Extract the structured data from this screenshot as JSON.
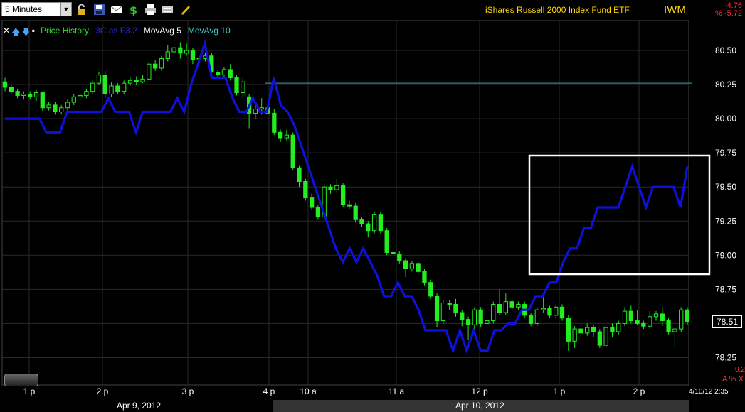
{
  "toolbar": {
    "timeframe": "5 Minutes",
    "icons": [
      "lock-icon",
      "save-icon",
      "mail-icon",
      "dollar-icon",
      "print-icon",
      "screen-icon",
      "pencil-icon"
    ]
  },
  "header": {
    "title": "iShares Russell 2000 Index Fund ETF",
    "symbol": "IWM",
    "change": "-4.76",
    "change_pct": "% -5.72"
  },
  "legend": {
    "price_history": "Price History",
    "indicator": "3C as F3.2",
    "ma5": "MovAvg 5",
    "ma10": "MovAvg 10"
  },
  "last_price": "78.51",
  "right_small": "0.25",
  "alx_label": "A % X",
  "timestamp": "4/10/12 2:35",
  "colors": {
    "background": "#000000",
    "candle": "#22ee22",
    "indicator": "#1010dd",
    "ma_line": "#2a8a8a",
    "grid": "#2a2a2a",
    "title": "#ffd800",
    "negative": "#ff3030"
  },
  "chart_data": {
    "type": "candlestick",
    "yaxis": {
      "ticks": [
        "80.50",
        "80.25",
        "80.00",
        "79.75",
        "79.50",
        "79.25",
        "79.00",
        "78.75",
        "78.50",
        "78.25"
      ],
      "ylim": [
        78.125,
        80.625
      ]
    },
    "xaxis": {
      "time_labels": [
        "1 p",
        "2 p",
        "3 p",
        "4 p",
        "10 a",
        "11 a",
        "12 p",
        "1 p",
        "2 p"
      ],
      "date_labels": [
        "Apr 9, 2012",
        "Apr 10, 2012"
      ]
    },
    "ma_level": 80.26,
    "candles": [
      [
        80.27,
        80.23,
        80.3,
        80.2
      ],
      [
        80.23,
        80.2,
        80.25,
        80.18
      ],
      [
        80.2,
        80.17,
        80.22,
        80.15
      ],
      [
        80.17,
        80.18,
        80.2,
        80.14
      ],
      [
        80.18,
        80.16,
        80.2,
        80.14
      ],
      [
        80.16,
        80.19,
        80.21,
        80.13
      ],
      [
        80.19,
        80.08,
        80.2,
        80.06
      ],
      [
        80.08,
        80.1,
        80.12,
        80.06
      ],
      [
        80.1,
        80.05,
        80.12,
        80.03
      ],
      [
        80.05,
        80.08,
        80.1,
        80.03
      ],
      [
        80.08,
        80.12,
        80.14,
        80.06
      ],
      [
        80.12,
        80.16,
        80.18,
        80.1
      ],
      [
        80.16,
        80.17,
        80.19,
        80.13
      ],
      [
        80.17,
        80.2,
        80.22,
        80.15
      ],
      [
        80.2,
        80.26,
        80.28,
        80.18
      ],
      [
        80.26,
        80.32,
        80.34,
        80.25
      ],
      [
        80.32,
        80.18,
        80.35,
        80.15
      ],
      [
        80.18,
        80.24,
        80.27,
        80.16
      ],
      [
        80.24,
        80.2,
        80.26,
        80.18
      ],
      [
        80.2,
        80.26,
        80.28,
        80.18
      ],
      [
        80.26,
        80.28,
        80.3,
        80.24
      ],
      [
        80.28,
        80.27,
        80.31,
        80.25
      ],
      [
        80.27,
        80.29,
        80.32,
        80.26
      ],
      [
        80.29,
        80.4,
        80.42,
        80.28
      ],
      [
        80.4,
        80.37,
        80.43,
        80.35
      ],
      [
        80.37,
        80.44,
        80.46,
        80.35
      ],
      [
        80.44,
        80.49,
        80.54,
        80.42
      ],
      [
        80.49,
        80.52,
        80.58,
        80.47
      ],
      [
        80.52,
        80.48,
        80.56,
        80.44
      ],
      [
        80.48,
        80.5,
        80.55,
        80.46
      ],
      [
        80.5,
        80.43,
        80.52,
        80.4
      ],
      [
        80.43,
        80.44,
        80.46,
        80.41
      ],
      [
        80.44,
        80.46,
        80.48,
        80.42
      ],
      [
        80.46,
        80.34,
        80.48,
        80.32
      ],
      [
        80.34,
        80.32,
        80.36,
        80.3
      ],
      [
        80.32,
        80.36,
        80.38,
        80.3
      ],
      [
        80.36,
        80.3,
        80.4,
        80.28
      ],
      [
        80.3,
        80.19,
        80.32,
        80.17
      ],
      [
        80.19,
        80.27,
        80.3,
        80.15
      ],
      [
        80.16,
        80.04,
        80.18,
        79.93
      ],
      [
        80.04,
        80.07,
        80.12,
        80.0
      ],
      [
        80.07,
        80.08,
        80.15,
        80.03
      ],
      [
        80.08,
        80.04,
        80.12,
        80.0
      ],
      [
        80.04,
        79.9,
        80.07,
        79.88
      ],
      [
        79.9,
        79.86,
        79.92,
        79.83
      ],
      [
        79.86,
        79.88,
        79.92,
        79.84
      ],
      [
        79.88,
        79.64,
        79.9,
        79.62
      ],
      [
        79.64,
        79.54,
        79.66,
        79.5
      ],
      [
        79.54,
        79.42,
        79.56,
        79.4
      ],
      [
        79.42,
        79.35,
        79.45,
        79.33
      ],
      [
        79.35,
        79.28,
        79.37,
        79.26
      ],
      [
        79.28,
        79.5,
        79.52,
        79.26
      ],
      [
        79.5,
        79.48,
        79.52,
        79.45
      ],
      [
        79.48,
        79.51,
        79.56,
        79.46
      ],
      [
        79.51,
        79.37,
        79.53,
        79.35
      ],
      [
        79.37,
        79.36,
        79.4,
        79.34
      ],
      [
        79.36,
        79.26,
        79.38,
        79.24
      ],
      [
        79.26,
        79.23,
        79.28,
        79.21
      ],
      [
        79.23,
        79.18,
        79.25,
        79.13
      ],
      [
        79.18,
        79.3,
        79.32,
        79.16
      ],
      [
        79.3,
        79.18,
        79.32,
        79.16
      ],
      [
        79.18,
        79.02,
        79.2,
        79.0
      ],
      [
        79.02,
        79.01,
        79.05,
        78.99
      ],
      [
        79.01,
        78.96,
        79.03,
        78.94
      ],
      [
        78.96,
        78.9,
        78.98,
        78.84
      ],
      [
        78.9,
        78.94,
        78.96,
        78.88
      ],
      [
        78.94,
        78.88,
        78.96,
        78.86
      ],
      [
        78.88,
        78.8,
        78.9,
        78.78
      ],
      [
        78.8,
        78.7,
        78.82,
        78.68
      ],
      [
        78.7,
        78.52,
        78.72,
        78.47
      ],
      [
        78.52,
        78.65,
        78.67,
        78.5
      ],
      [
        78.65,
        78.64,
        78.67,
        78.6
      ],
      [
        78.64,
        78.58,
        78.68,
        78.55
      ],
      [
        78.58,
        78.53,
        78.6,
        78.48
      ],
      [
        78.53,
        78.49,
        78.55,
        78.38
      ],
      [
        78.49,
        78.6,
        78.62,
        78.42
      ],
      [
        78.6,
        78.5,
        78.62,
        78.47
      ],
      [
        78.5,
        78.52,
        78.55,
        78.46
      ],
      [
        78.52,
        78.64,
        78.66,
        78.5
      ],
      [
        78.64,
        78.58,
        78.75,
        78.56
      ],
      [
        78.58,
        78.66,
        78.72,
        78.56
      ],
      [
        78.66,
        78.62,
        78.68,
        78.6
      ],
      [
        78.62,
        78.64,
        78.66,
        78.6
      ],
      [
        78.64,
        78.56,
        78.66,
        78.54
      ],
      [
        78.56,
        78.5,
        78.58,
        78.48
      ],
      [
        78.5,
        78.6,
        78.62,
        78.48
      ],
      [
        78.6,
        78.61,
        78.7,
        78.58
      ],
      [
        78.61,
        78.56,
        78.63,
        78.54
      ],
      [
        78.56,
        78.62,
        78.64,
        78.54
      ],
      [
        78.62,
        78.54,
        78.64,
        78.52
      ],
      [
        78.54,
        78.37,
        78.56,
        78.3
      ],
      [
        78.37,
        78.46,
        78.48,
        78.32
      ],
      [
        78.46,
        78.43,
        78.48,
        78.38
      ],
      [
        78.43,
        78.47,
        78.5,
        78.41
      ],
      [
        78.47,
        78.44,
        78.49,
        78.4
      ],
      [
        78.44,
        78.34,
        78.46,
        78.32
      ],
      [
        78.34,
        78.47,
        78.49,
        78.32
      ],
      [
        78.47,
        78.44,
        78.5,
        78.4
      ],
      [
        78.44,
        78.5,
        78.52,
        78.42
      ],
      [
        78.5,
        78.59,
        78.62,
        78.48
      ],
      [
        78.59,
        78.52,
        78.63,
        78.5
      ],
      [
        78.52,
        78.5,
        78.6,
        78.49
      ],
      [
        78.5,
        78.48,
        78.52,
        78.46
      ],
      [
        78.48,
        78.55,
        78.59,
        78.46
      ],
      [
        78.55,
        78.57,
        78.59,
        78.52
      ],
      [
        78.57,
        78.52,
        78.62,
        78.48
      ],
      [
        78.52,
        78.44,
        78.54,
        78.42
      ],
      [
        78.44,
        78.46,
        78.48,
        78.33
      ],
      [
        78.46,
        78.6,
        78.62,
        78.44
      ],
      [
        78.6,
        78.51,
        78.62,
        78.49
      ]
    ],
    "indicator": [
      80.0,
      80.0,
      80.0,
      80.0,
      80.0,
      80.0,
      79.9,
      79.9,
      79.9,
      80.05,
      80.05,
      80.05,
      80.05,
      80.05,
      80.05,
      80.15,
      80.05,
      80.05,
      80.05,
      79.9,
      80.05,
      80.05,
      80.05,
      80.05,
      80.05,
      80.15,
      80.05,
      80.25,
      80.4,
      80.55,
      80.3,
      80.3,
      80.3,
      80.15,
      80.05,
      80.05,
      80.15,
      80.05,
      80.05,
      80.3,
      80.1,
      80.05,
      79.95,
      79.8,
      79.65,
      79.5,
      79.35,
      79.2,
      79.05,
      78.95,
      79.05,
      78.95,
      79.05,
      78.95,
      78.85,
      78.7,
      78.7,
      78.8,
      78.7,
      78.7,
      78.6,
      78.45,
      78.45,
      78.45,
      78.45,
      78.3,
      78.45,
      78.3,
      78.45,
      78.3,
      78.3,
      78.45,
      78.45,
      78.5,
      78.5,
      78.6,
      78.6,
      78.7,
      78.7,
      78.8,
      78.8,
      78.95,
      79.05,
      79.05,
      79.2,
      79.2,
      79.35,
      79.35,
      79.35,
      79.35,
      79.5,
      79.65,
      79.5,
      79.35,
      79.5,
      79.5,
      79.5,
      79.5,
      79.35,
      79.65
    ]
  }
}
